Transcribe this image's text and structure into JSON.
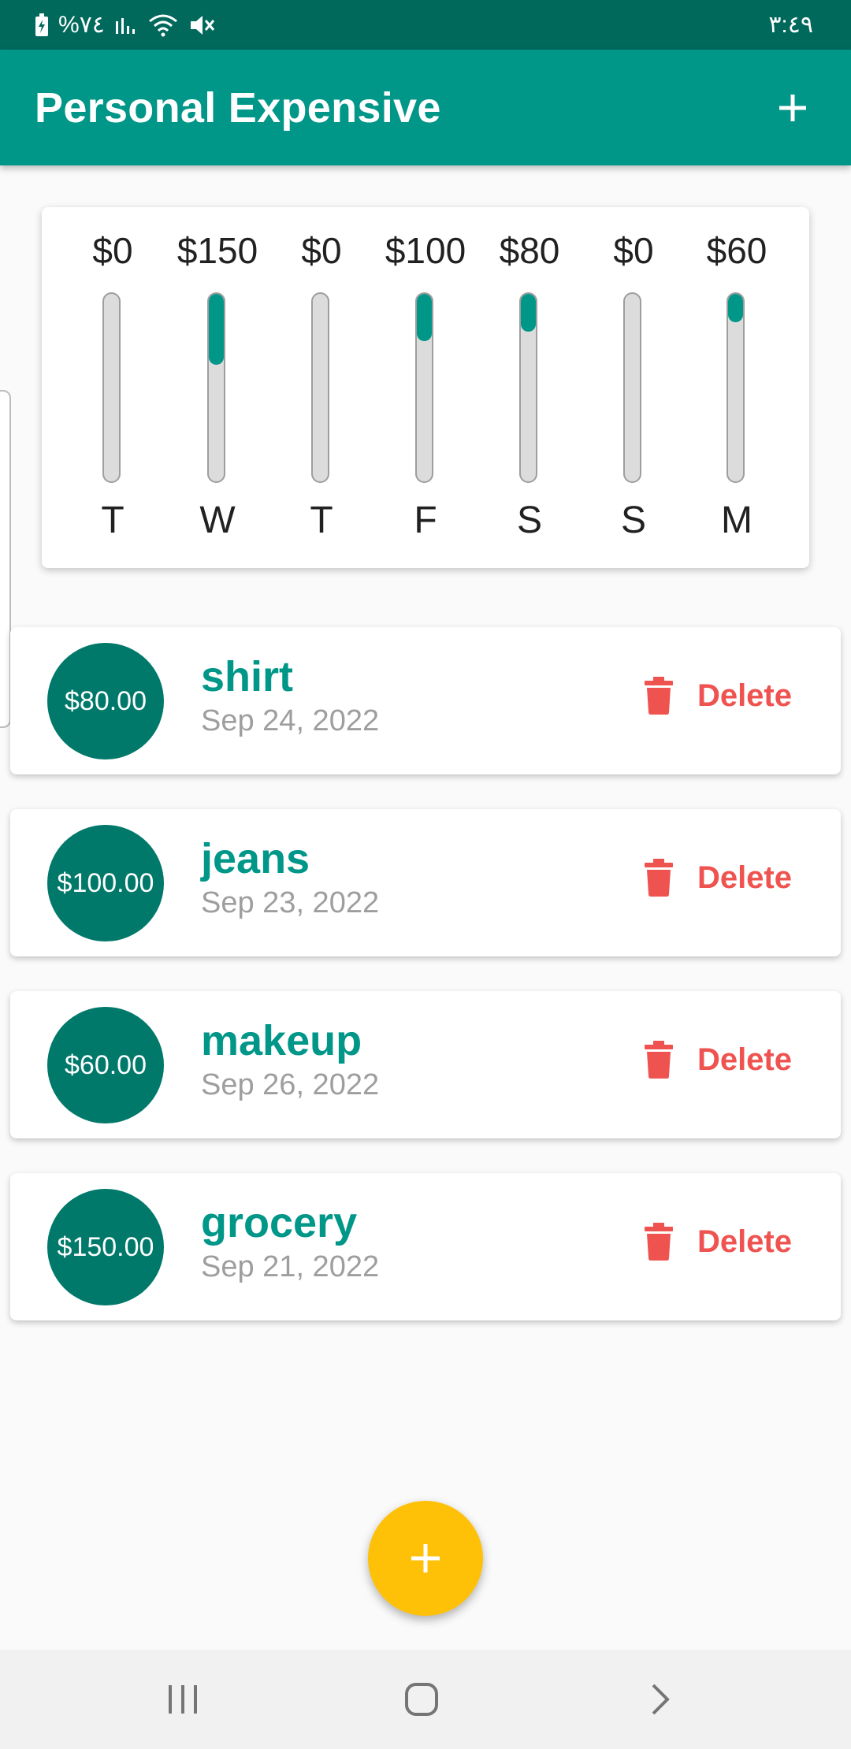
{
  "status_bar": {
    "battery_text": "%٧٤",
    "time": "٣:٤٩",
    "icons": [
      "battery-charging-icon",
      "signal-icon",
      "wifi-icon",
      "mute-icon"
    ]
  },
  "app_bar": {
    "title": "Personal Expensive",
    "add_icon": "plus-icon"
  },
  "chart_data": {
    "type": "bar",
    "categories": [
      "T",
      "W",
      "T",
      "F",
      "S",
      "S",
      "M"
    ],
    "values": [
      0,
      150,
      0,
      100,
      80,
      0,
      60
    ],
    "amount_labels": [
      "$0",
      "$150",
      "$0",
      "$100",
      "$80",
      "$0",
      "$60"
    ],
    "fill_fraction": [
      0,
      0.38,
      0,
      0.25,
      0.2,
      0,
      0.15
    ]
  },
  "transactions": [
    {
      "amount": "$80.00",
      "title": "shirt",
      "date": "Sep 24, 2022",
      "delete_label": "Delete"
    },
    {
      "amount": "$100.00",
      "title": "jeans",
      "date": "Sep 23, 2022",
      "delete_label": "Delete"
    },
    {
      "amount": "$60.00",
      "title": "makeup",
      "date": "Sep 26, 2022",
      "delete_label": "Delete"
    },
    {
      "amount": "$150.00",
      "title": "grocery",
      "date": "Sep 21, 2022",
      "delete_label": "Delete"
    }
  ],
  "colors": {
    "primary": "#009688",
    "primary_dark": "#00695c",
    "avatar": "#00796b",
    "delete": "#ef5350",
    "fab": "#ffc107"
  },
  "fab": {
    "icon": "plus-icon"
  },
  "nav_bar": {
    "icons": [
      "recent-apps-icon",
      "home-icon",
      "back-icon"
    ]
  }
}
